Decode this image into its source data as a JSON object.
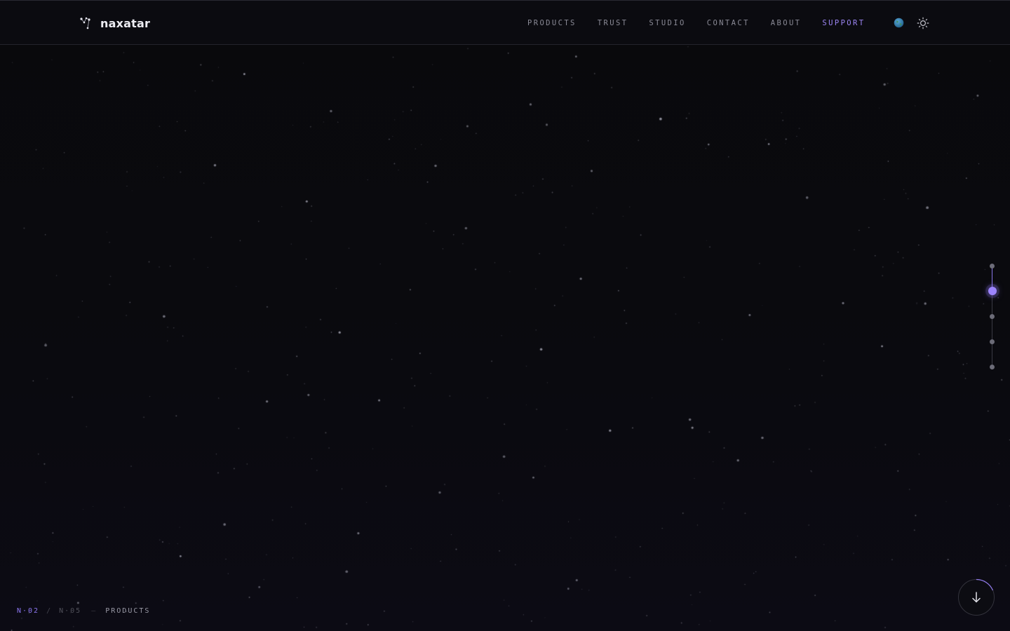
{
  "brand": {
    "name": "naxatar",
    "icon": "constellation-icon"
  },
  "nav": {
    "items": [
      {
        "label": "PRODUCTS"
      },
      {
        "label": "TRUST"
      },
      {
        "label": "STUDIO"
      },
      {
        "label": "CONTACT"
      },
      {
        "label": "ABOUT"
      },
      {
        "label": "SUPPORT",
        "active": true
      }
    ],
    "locale_icon": "globe-icon",
    "theme_icon": "sun-icon"
  },
  "section_indicator": {
    "current": "N·02",
    "separator": "/",
    "total": "N·05",
    "dash": "—",
    "section_name": "PRODUCTS"
  },
  "side_progress": {
    "total_sections": 5,
    "active_index": 1
  },
  "scroll_button": {
    "icon": "arrow-down-icon"
  },
  "colors": {
    "background": "#09090c",
    "accent": "#9c84ff",
    "nav_text": "#8a8a96",
    "brand_text": "#ececf2"
  }
}
